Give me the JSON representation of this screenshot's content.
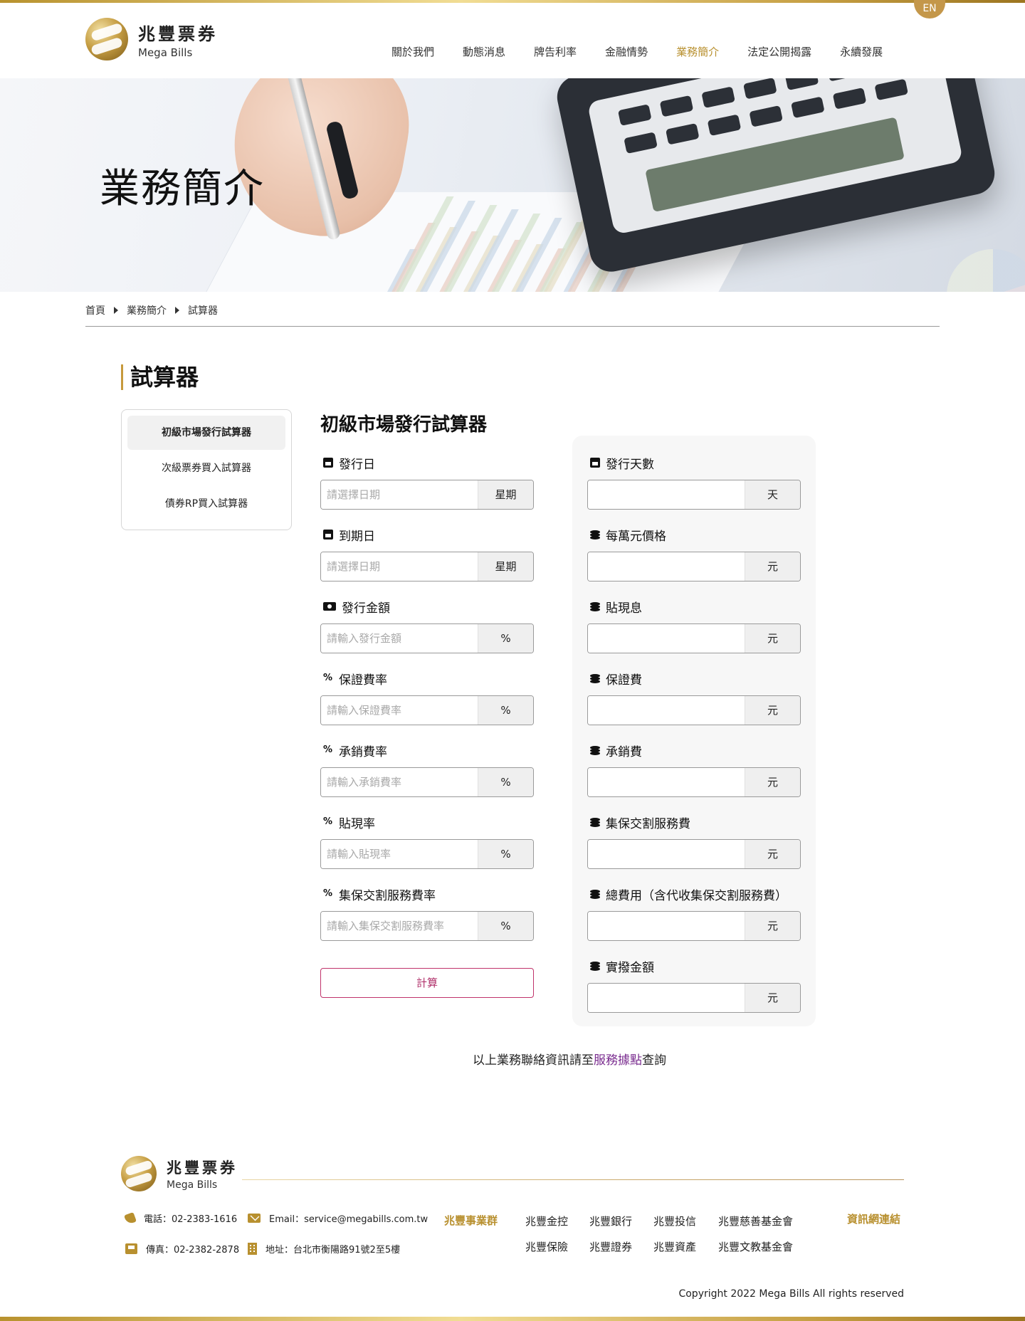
{
  "brand": {
    "name_zh": "兆豐票券",
    "name_en": "Mega Bills"
  },
  "language_toggle": "EN",
  "nav": {
    "items": [
      {
        "label": "關於我們"
      },
      {
        "label": "動態消息"
      },
      {
        "label": "牌告利率"
      },
      {
        "label": "金融情勢"
      },
      {
        "label": "業務簡介",
        "active": true
      },
      {
        "label": "法定公開揭露"
      },
      {
        "label": "永續發展"
      }
    ]
  },
  "banner": {
    "title": "業務簡介"
  },
  "breadcrumb": [
    "首頁",
    "業務簡介",
    "試算器"
  ],
  "section": {
    "title": "試算器"
  },
  "side_menu": {
    "items": [
      {
        "label": "初級市場發行試算器",
        "active": true
      },
      {
        "label": "次級票券買入試算器"
      },
      {
        "label": "債券RP買入試算器"
      }
    ]
  },
  "calculator": {
    "title": "初級市場發行試算器",
    "left_fields": [
      {
        "label": "發行日",
        "icon": "calendar-icon",
        "placeholder": "請選擇日期",
        "value": "",
        "addon": "星期"
      },
      {
        "label": "到期日",
        "icon": "calendar-check-icon",
        "placeholder": "請選擇日期",
        "value": "",
        "addon": "星期"
      },
      {
        "label": "發行金額",
        "icon": "money-bill-icon",
        "placeholder": "請輸入發行金額",
        "value": "",
        "addon": "%"
      },
      {
        "label": "保證費率",
        "icon": "percent-icon",
        "placeholder": "請輸入保證費率",
        "value": "",
        "addon": "%"
      },
      {
        "label": "承銷費率",
        "icon": "percent-icon",
        "placeholder": "請輸入承銷費率",
        "value": "",
        "addon": "%"
      },
      {
        "label": "貼現率",
        "icon": "percent-icon",
        "placeholder": "請輸入貼現率",
        "value": "",
        "addon": "%"
      },
      {
        "label": "集保交割服務費率",
        "icon": "percent-icon",
        "placeholder": "請輸入集保交割服務費率",
        "value": "",
        "addon": "%"
      }
    ],
    "button_label": "計算",
    "right_fields": [
      {
        "label": "發行天數",
        "icon": "calendar-grid-icon",
        "value": "",
        "addon": "天"
      },
      {
        "label": "每萬元價格",
        "icon": "coins-icon",
        "value": "",
        "addon": "元"
      },
      {
        "label": "貼現息",
        "icon": "coins-icon",
        "value": "",
        "addon": "元"
      },
      {
        "label": "保證費",
        "icon": "coins-icon",
        "value": "",
        "addon": "元"
      },
      {
        "label": "承銷費",
        "icon": "coins-icon",
        "value": "",
        "addon": "元"
      },
      {
        "label": "集保交割服務費",
        "icon": "coins-icon",
        "value": "",
        "addon": "元"
      },
      {
        "label": "總費用（含代收集保交割服務費）",
        "icon": "coins-icon",
        "value": "",
        "addon": "元"
      },
      {
        "label": "實撥金額",
        "icon": "coins-icon",
        "value": "",
        "addon": "元"
      }
    ]
  },
  "note": {
    "prefix": "以上業務聯絡資訊請至",
    "link": "服務據點",
    "suffix": "查詢"
  },
  "footer": {
    "phone": "電話：02-2383-1616",
    "email": "Email：service@megabills.com.tw",
    "fax": "傳真：02-2382-2878",
    "address": "地址：台北市衡陽路91號2至5樓",
    "group_title": "兆豐事業群",
    "group_links": [
      "兆豐金控",
      "兆豐銀行",
      "兆豐投信",
      "兆豐慈善基金會",
      "兆豐保險",
      "兆豐證券",
      "兆豐資產",
      "兆豐文教基金會"
    ],
    "info_link": "資訊網連結",
    "copyright": "Copyright 2022 Mega Bills All rights reserved"
  },
  "colors": {
    "gold": "#b8902f",
    "accent_link": "#7a2c8f",
    "button_border": "#c0336b"
  }
}
